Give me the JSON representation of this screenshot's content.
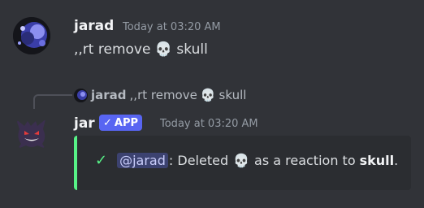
{
  "message1": {
    "username": "jarad",
    "timestamp": "Today at 03:20 AM",
    "text_prefix": ",,rt remove",
    "emoji": "💀",
    "text_suffix": "skull"
  },
  "reply": {
    "username": "jarad",
    "text_prefix": ",,rt remove",
    "emoji": "💀",
    "text_suffix": "skull"
  },
  "message2": {
    "username": "jar",
    "badge": "APP",
    "timestamp": "Today at 03:20 AM",
    "embed": {
      "mention": "@jarad",
      "text_a": ": Deleted",
      "emoji": "💀",
      "text_b": "as a reaction to",
      "bold": "skull",
      "text_c": ".",
      "accent_color": "#57f287"
    }
  },
  "colors": {
    "background": "#313338",
    "badge": "#5865f2",
    "mention_bg": "#3c4270"
  }
}
